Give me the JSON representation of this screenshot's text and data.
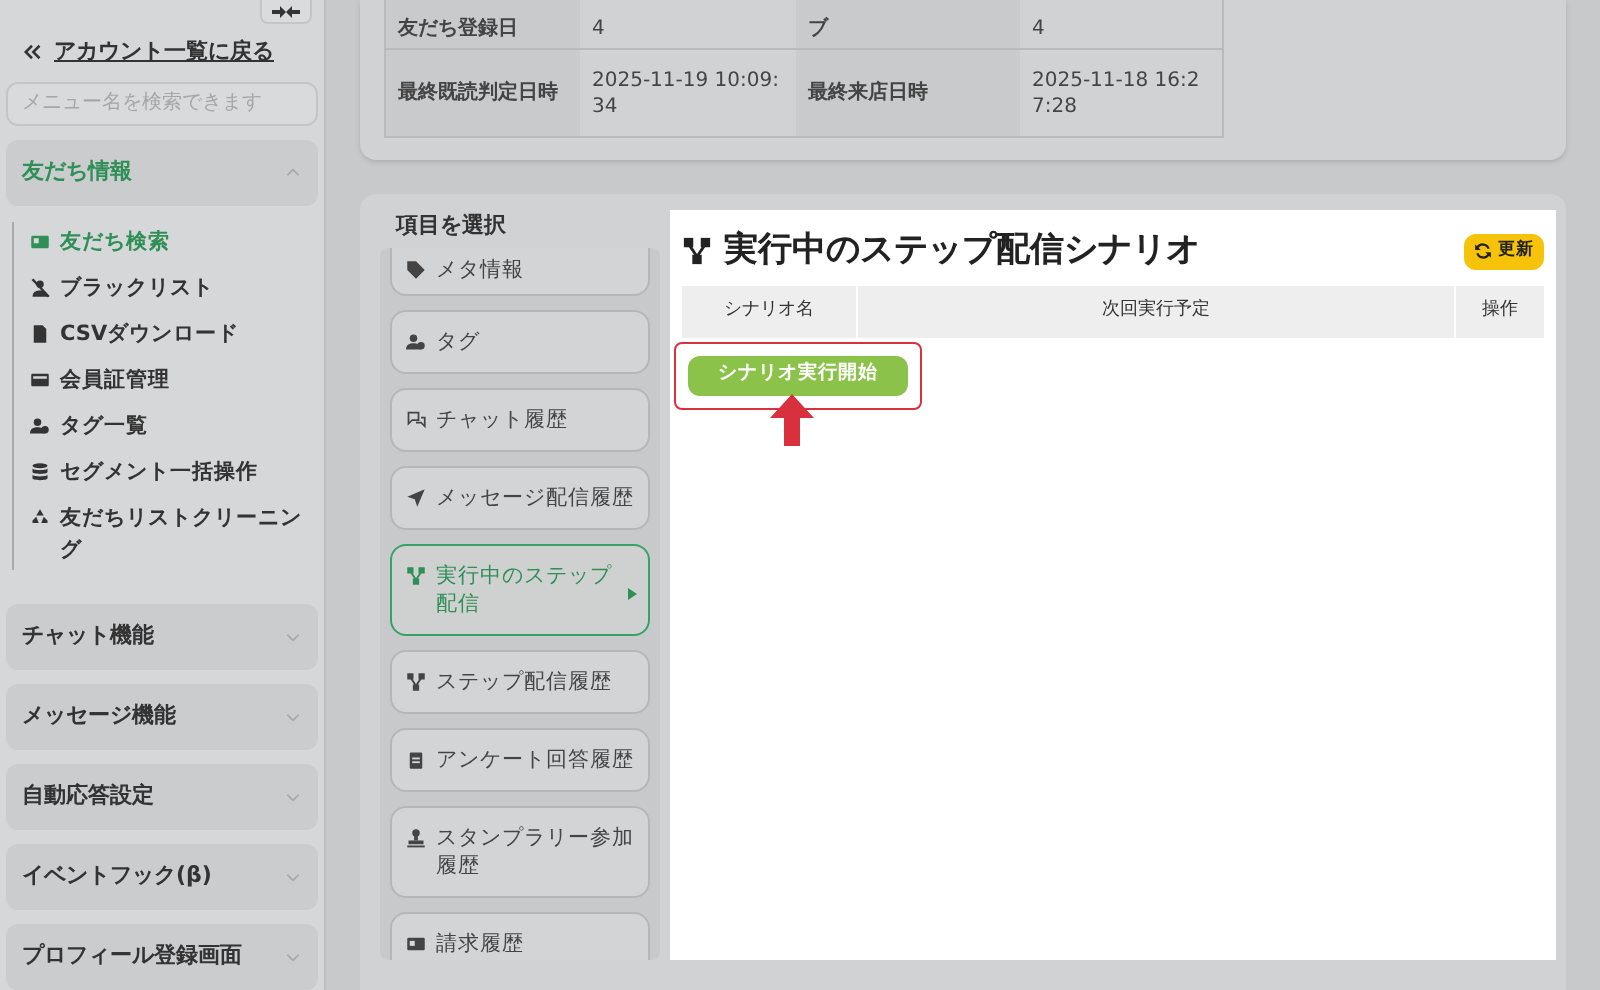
{
  "sidebar": {
    "back_link": "アカウント一覧に戻る",
    "search": {
      "placeholder": "メニュー名を検索できます"
    },
    "sections": [
      {
        "label": "友だち情報",
        "expanded": true,
        "children": [
          {
            "label": "友だち検索",
            "selected": true
          },
          {
            "label": "ブラックリスト",
            "selected": false
          },
          {
            "label": "CSVダウンロード",
            "selected": false
          },
          {
            "label": "会員証管理",
            "selected": false
          },
          {
            "label": "タグ一覧",
            "selected": false
          },
          {
            "label": "セグメント一括操作",
            "selected": false
          },
          {
            "label": "友だちリストクリーニング",
            "selected": false
          }
        ]
      },
      {
        "label": "チャット機能",
        "expanded": false
      },
      {
        "label": "メッセージ機能",
        "expanded": false
      },
      {
        "label": "自動応答設定",
        "expanded": false
      },
      {
        "label": "イベントフック(β)",
        "expanded": false
      },
      {
        "label": "プロフィール登録画面",
        "expanded": false
      }
    ]
  },
  "profile_table": {
    "rows": [
      [
        "友だち登録日",
        "4",
        "ブ",
        "4"
      ],
      [
        "最終既読判定日時",
        "2025-11-19 10:09:34",
        "最終来店日時",
        "2025-11-18 16:27:28"
      ]
    ]
  },
  "item_selector": {
    "title": "項目を選択",
    "items": [
      {
        "label": "メタ情報",
        "selected": false
      },
      {
        "label": "タグ",
        "selected": false
      },
      {
        "label": "チャット履歴",
        "selected": false
      },
      {
        "label": "メッセージ配信履歴",
        "selected": false
      },
      {
        "label": "実行中のステップ配信",
        "selected": true
      },
      {
        "label": "ステップ配信履歴",
        "selected": false
      },
      {
        "label": "アンケート回答履歴",
        "selected": false
      },
      {
        "label": "スタンプラリー参加履歴",
        "selected": false
      },
      {
        "label": "請求履歴",
        "selected": false
      }
    ]
  },
  "panel": {
    "title": "実行中のステップ配信シナリオ",
    "refresh_button": "更新",
    "table": {
      "columns": [
        "シナリオ名",
        "次回実行予定",
        "操作"
      ]
    },
    "start_button": {
      "label": "シナリオ実行開始",
      "highlighted": true
    }
  }
}
